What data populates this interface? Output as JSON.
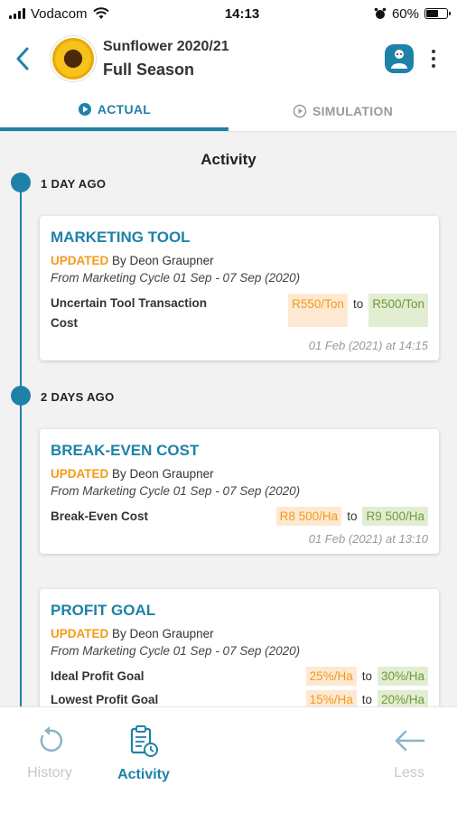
{
  "status_bar": {
    "carrier": "Vodacom",
    "time": "14:13",
    "battery_text": "60%",
    "battery_level": 0.6
  },
  "header": {
    "title": "Sunflower 2020/21",
    "subtitle": "Full Season"
  },
  "tabs": [
    {
      "label": "ACTUAL",
      "active": true
    },
    {
      "label": "SIMULATION",
      "active": false
    }
  ],
  "section_title": "Activity",
  "groups": [
    {
      "label": "1 DAY AGO"
    },
    {
      "label": "2 DAYS AGO"
    }
  ],
  "cards": [
    {
      "title": "MARKETING TOOL",
      "status": "UPDATED",
      "by": "By Deon Graupner",
      "source": "From Marketing Cycle 01 Sep - 07 Sep (2020)",
      "changes": [
        {
          "label_line1": "Uncertain Tool Transaction",
          "label_line2": "Cost",
          "old": "R550/Ton",
          "to": "to",
          "new": "R500/Ton"
        }
      ],
      "timestamp": "01 Feb (2021) at 14:15"
    },
    {
      "title": "BREAK-EVEN COST",
      "status": "UPDATED",
      "by": "By Deon Graupner",
      "source": "From Marketing Cycle 01 Sep - 07 Sep (2020)",
      "changes": [
        {
          "label": "Break-Even Cost",
          "old": "R8 500/Ha",
          "to": "to",
          "new": "R9 500/Ha"
        }
      ],
      "timestamp": "01 Feb (2021) at 13:10"
    },
    {
      "title": "PROFIT GOAL",
      "status": "UPDATED",
      "by": "By Deon Graupner",
      "source": "From Marketing Cycle 01 Sep - 07 Sep (2020)",
      "changes": [
        {
          "label": "Ideal Profit Goal",
          "old": "25%/Ha",
          "to": "to",
          "new": "30%/Ha"
        },
        {
          "label": "Lowest Profit Goal",
          "old": "15%/Ha",
          "to": "to",
          "new": "20%/Ha"
        }
      ]
    }
  ],
  "bottom_nav": [
    {
      "label": "History",
      "icon": "history-icon"
    },
    {
      "label": "Activity",
      "icon": "clipboard-clock-icon"
    },
    {
      "label": "Less",
      "icon": "arrow-left-icon"
    }
  ],
  "colors": {
    "primary": "#1e82a8",
    "updated": "#f39a1a",
    "new_value": "#6f9a3a",
    "old_value_bg": "#fde9d2",
    "new_value_bg": "#e2edd2"
  }
}
